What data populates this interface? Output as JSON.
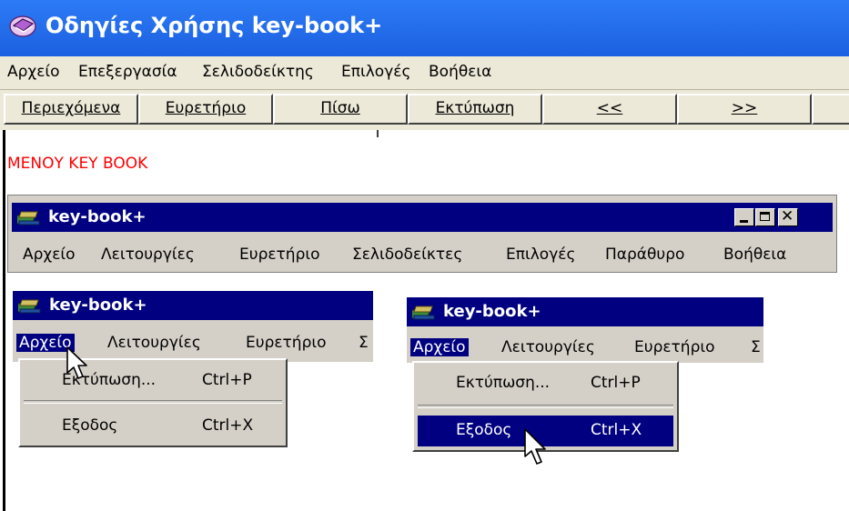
{
  "app": {
    "title": "Οδηγίες Χρήσης key-book+"
  },
  "menubar": {
    "items": [
      "Αρχείο",
      "Επεξεργασία",
      "Σελιδοδείκτης",
      "Επιλογές",
      "Βοήθεια"
    ]
  },
  "toolbar": {
    "buttons": [
      "Περιεχόμενα",
      "Ευρετήριο",
      "Πίσω",
      "Εκτύπωση",
      "<<",
      ">>"
    ]
  },
  "content": {
    "heading": "ΜΕΝΟΥ KEY BOOK"
  },
  "keybook_window": {
    "title": "key-book+",
    "menu": [
      "Αρχείο",
      "Λειτουργίες",
      "Ευρετήριο",
      "Σελιδοδείκτες",
      "Επιλογές",
      "Παράθυρο",
      "Βοήθεια"
    ]
  },
  "example_left": {
    "title": "key-book+",
    "menu": [
      "Αρχείο",
      "Λειτουργίες",
      "Ευρετήριο",
      "Σ"
    ],
    "dropdown": [
      {
        "label": "Εκτύπωση...",
        "shortcut": "Ctrl+P"
      },
      {
        "label": "Εξοδος",
        "shortcut": "Ctrl+X"
      }
    ]
  },
  "example_right": {
    "title": "key-book+",
    "menu": [
      "Αρχείο",
      "Λειτουργίες",
      "Ευρετήριο",
      "Σ"
    ],
    "dropdown": [
      {
        "label": "Εκτύπωση...",
        "shortcut": "Ctrl+P"
      },
      {
        "label": "Εξοδος",
        "shortcut": "Ctrl+X"
      }
    ],
    "highlighted_item": "Εξοδος"
  },
  "icons": {
    "app_icon": "help-book-icon",
    "window_icon": "books-icon",
    "cursor": "mouse-pointer-icon"
  },
  "colors": {
    "help_titlebar": "#1b60e0",
    "classic_titlebar": "#000080",
    "heading_text": "#ff0000",
    "chrome": "#d4d0c8"
  }
}
